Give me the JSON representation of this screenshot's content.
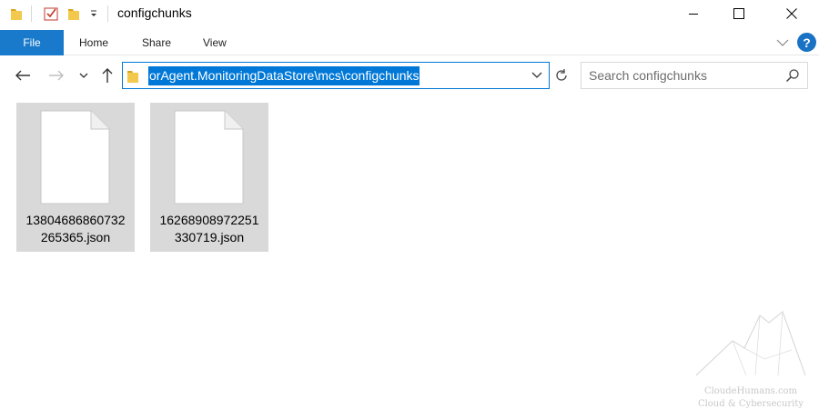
{
  "window": {
    "title": "configchunks",
    "controls": {
      "minimize_icon": "minimize-icon",
      "maximize_icon": "maximize-icon",
      "close_icon": "close-icon"
    }
  },
  "quick_access": {
    "icons": [
      "folder-icon",
      "properties-check-icon",
      "new-folder-icon",
      "customize-dropdown-icon"
    ]
  },
  "ribbon": {
    "tabs": [
      {
        "label": "File",
        "active": true
      },
      {
        "label": "Home"
      },
      {
        "label": "Share"
      },
      {
        "label": "View"
      }
    ],
    "help_label": "?"
  },
  "navigation": {
    "address_path": "orAgent.MonitoringDataStore\\mcs\\configchunks",
    "search_placeholder": "Search configchunks"
  },
  "files": [
    {
      "name": "13804686860732265365.json",
      "line1": "13804686860732",
      "line2": "265365.json"
    },
    {
      "name": "16268908972251330719.json",
      "line1": "16268908972251",
      "line2": "330719.json"
    }
  ],
  "watermark": {
    "site": "CloudeHumans.com",
    "tagline": "Cloud & Cybersecurity"
  },
  "colors": {
    "accent": "#0078d7",
    "file_tab": "#1979ca",
    "selection_bg": "#d9d9d9"
  }
}
